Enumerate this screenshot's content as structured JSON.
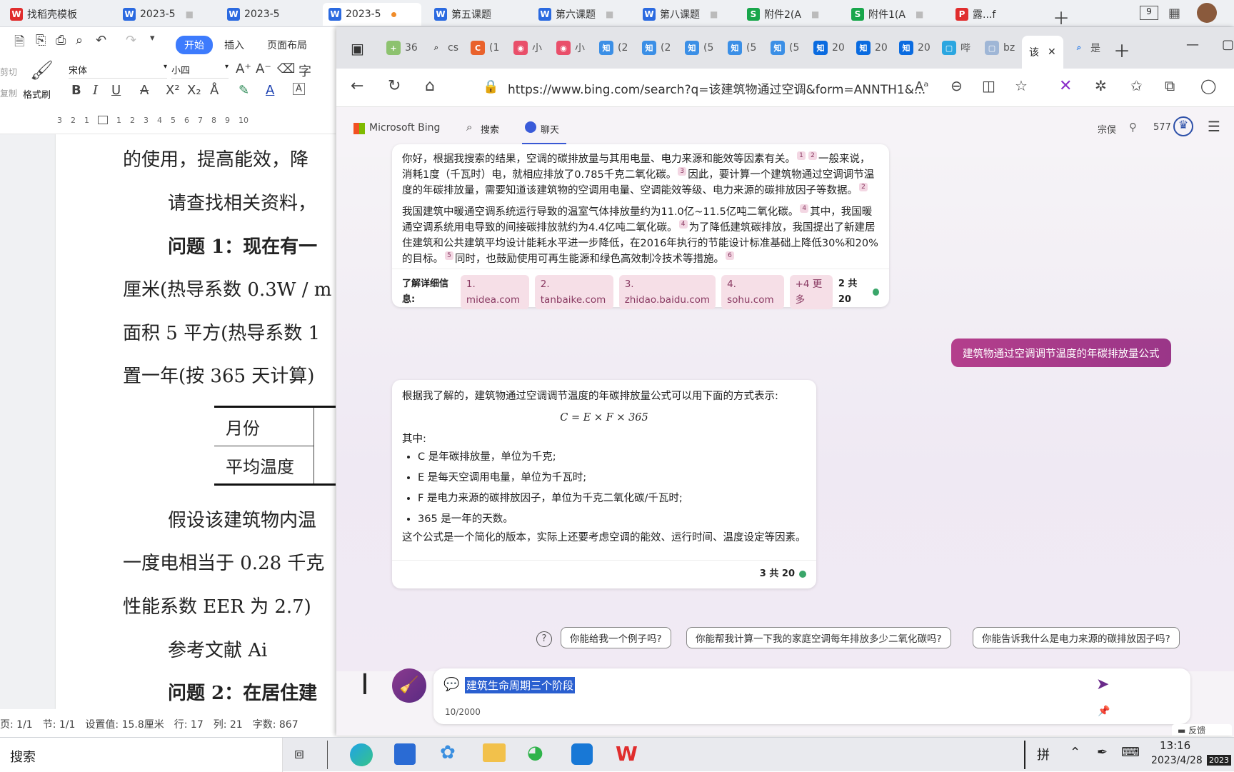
{
  "wps": {
    "tabs": [
      {
        "label": "找稻壳模板",
        "color": "#e02d2d",
        "glyph": "W"
      },
      {
        "label": "2023-5",
        "color": "#2b6ae0",
        "glyph": "W"
      },
      {
        "label": "2023-5",
        "color": "#2b6ae0",
        "glyph": "W"
      },
      {
        "label": "2023-5",
        "color": "#2b6ae0",
        "glyph": "W"
      },
      {
        "label": "第五课题",
        "color": "#2b6ae0",
        "glyph": "W"
      },
      {
        "label": "第六课题",
        "color": "#2b6ae0",
        "glyph": "W"
      },
      {
        "label": "第八课题",
        "color": "#2b6ae0",
        "glyph": "W"
      },
      {
        "label": "附件2(A",
        "color": "#18a64b",
        "glyph": "S"
      },
      {
        "label": "附件1(A",
        "color": "#18a64b",
        "glyph": "S"
      },
      {
        "label": "露...f",
        "color": "#e02d2d",
        "glyph": "P"
      }
    ],
    "ribbon_tabs": [
      "开始",
      "插入",
      "页面布局"
    ],
    "font_name": "宋体",
    "font_size": "小四",
    "format_painter": "格式刷",
    "cut": "剪切",
    "copy": "复制",
    "ruler_ticks": [
      "3",
      "2",
      "1",
      "",
      "1",
      "2",
      "3",
      "4",
      "5",
      "6",
      "7",
      "8",
      "9",
      "10"
    ],
    "doc_lines": [
      "的使用，提高能效，降",
      "请查找相关资料，",
      "问题 1：现在有一",
      "厘米(热导系数 0.3W / m",
      "面积 5 平方(热导系数 1",
      "置一年(按 365 天计算)",
      "假设该建筑物内温",
      "一度电相当于 0.28 千克",
      "性能系数 EER 为 2.7)",
      "参考文献  Ai",
      "问题 2：在居住建"
    ],
    "table": {
      "row1": "月份",
      "row2": "平均温度"
    },
    "status": {
      "page": "页: 1/1",
      "section": "节: 1/1",
      "setting": "设置值: 15.8厘米",
      "row": "行: 17",
      "col": "列: 21",
      "words": "字数: 867"
    }
  },
  "edge": {
    "tabs": [
      "36",
      "cs",
      "(1",
      "小",
      "小",
      "(2",
      "(2",
      "(5",
      "(5",
      "(5",
      "20",
      "20",
      "20",
      "哔",
      "bz",
      "该",
      "是"
    ],
    "url": "https://www.bing.com/search?q=该建筑物通过空调&form=ANNTH1&...",
    "bing": {
      "logo": "Microsoft Bing",
      "nav_search": "搜索",
      "nav_chat": "聊天",
      "user": "宗俣",
      "points": "577"
    },
    "msg1": {
      "p1": "你好，根据我搜索的结果，空调的碳排放量与其用电量、电力来源和能效等因素有关。",
      "p1b": "一般来说，消耗1度（千瓦时）电，就相应排放了0.785千克二氧化碳。",
      "p1c": "因此，要计算一个建筑物通过空调调节温度的年碳排放量，需要知道该建筑物的空调用电量、空调能效等级、电力来源的碳排放因子等数据。",
      "p2": "我国建筑中暖通空调系统运行导致的温室气体排放量约为11.0亿~11.5亿吨二氧化碳。",
      "p2b": "其中，我国暖通空调系统用电导致的间接碳排放就约为4.4亿吨二氧化碳。",
      "p2c": "为了降低建筑碳排放，我国提出了新建居住建筑和公共建筑平均设计能耗水平进一步降低，在2016年执行的节能设计标准基础上降低30%和20%的目标。",
      "p2d": "同时，也鼓励使用可再生能源和绿色高效制冷技术等措施。",
      "learn_more": "了解详细信息:",
      "sources": [
        "1. midea.com",
        "2. tanbaike.com",
        "3. zhidao.baidu.com",
        "4. sohu.com",
        "+4 更多"
      ],
      "count": "2 共 20"
    },
    "user_msg": "建筑物通过空调调节温度的年碳排放量公式",
    "msg2": {
      "intro": "根据我了解的，建筑物通过空调调节温度的年碳排放量公式可以用下面的方式表示:",
      "formula": "C = E × F × 365",
      "where": "其中:",
      "items": [
        "C 是年碳排放量，单位为千克;",
        "E 是每天空调用电量，单位为千瓦时;",
        "F 是电力来源的碳排放因子，单位为千克二氧化碳/千瓦时;",
        "365 是一年的天数。"
      ],
      "note": "这个公式是一个简化的版本，实际上还要考虑空调的能效、运行时间、温度设定等因素。",
      "count": "3 共 20"
    },
    "suggestions": [
      "你能给我一个例子吗?",
      "你能帮我计算一下我的家庭空调每年排放多少二氧化碳吗?",
      "你能告诉我什么是电力来源的碳排放因子吗?"
    ],
    "input_value": "建筑生命周期三个阶段",
    "char_count": "10/2000",
    "feedback": "反馈"
  },
  "taskbar": {
    "search": "搜索",
    "ime": "拼",
    "time": "13:16",
    "date": "2023/4/28",
    "date_badge": "2023"
  }
}
